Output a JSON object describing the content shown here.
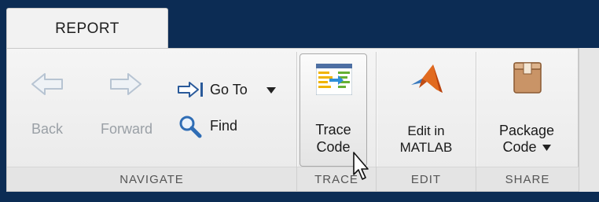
{
  "tabs": [
    {
      "label": "REPORT"
    }
  ],
  "sections": {
    "navigate": {
      "label": "NAVIGATE",
      "back_label": "Back",
      "forward_label": "Forward",
      "goto_label": "Go To",
      "find_label": "Find"
    },
    "trace": {
      "label": "TRACE",
      "trace_code_line1": "Trace",
      "trace_code_line2": "Code"
    },
    "edit": {
      "label": "EDIT",
      "edit_line1": "Edit in",
      "edit_line2": "MATLAB"
    },
    "share": {
      "label": "SHARE",
      "package_line1": "Package",
      "package_line2": "Code"
    }
  },
  "icons": {
    "back": "left-arrow-icon",
    "forward": "right-arrow-icon",
    "goto": "goto-arrow-icon",
    "find": "magnifier-icon",
    "trace": "trace-code-icon",
    "edit": "matlab-logo-icon",
    "package": "package-box-icon",
    "cursor": "mouse-pointer-icon"
  },
  "colors": {
    "title_bar": "#0c2c54",
    "ribbon": "#f2f2f2",
    "matlab_orange": "#e16a1f",
    "package_brown": "#c99467"
  }
}
